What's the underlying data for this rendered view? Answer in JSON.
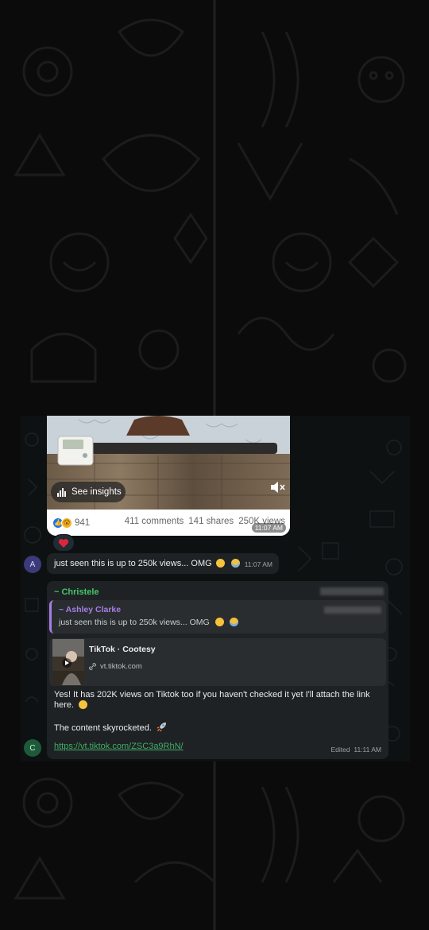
{
  "post_card": {
    "insights_label": "See insights",
    "reaction_count": "941",
    "comments": "411 comments",
    "shares": "141 shares",
    "views": "250K views",
    "time": "11:07 AM",
    "reaction_emoji": "❤️"
  },
  "messages": [
    {
      "avatar_initial": "A",
      "text": "just seen this is up to 250k views... OMG",
      "time": "11:07 AM"
    }
  ],
  "reply_message": {
    "avatar_initial": "C",
    "sender": "~ Christele",
    "quote": {
      "name": "~ Ashley Clarke",
      "text": "just seen this is up to 250k views... OMG"
    },
    "preview": {
      "title": "TikTok · Cootesy",
      "domain": "vt.tiktok.com"
    },
    "text_line1": "Yes! It has 202K views on Tiktok too if you haven't checked it yet I'll attach the link here.",
    "text_line2": "The content skyrocketed.",
    "link": "https://vt.tiktok.com/ZSC3a9RhN/",
    "status": "Edited",
    "time": "11:11 AM"
  },
  "colors": {
    "sender_green": "#45c46a",
    "quote_purple": "#a57ee8",
    "link_green": "#3fae67",
    "bubble": "#1f2224"
  }
}
